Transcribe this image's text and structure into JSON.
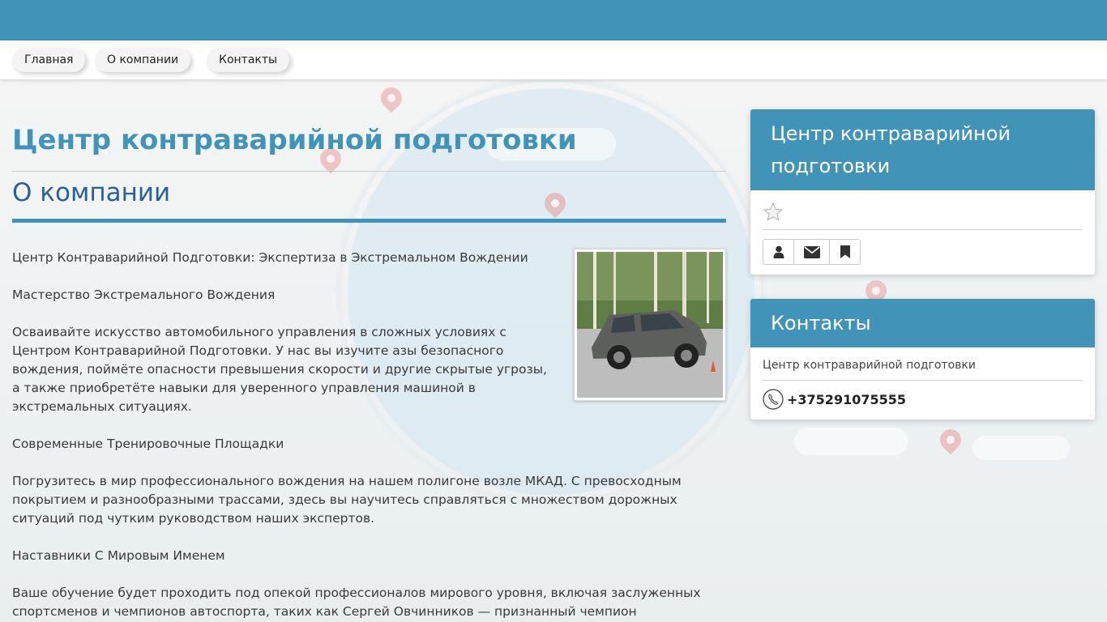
{
  "nav": {
    "items": [
      {
        "label": "Главная"
      },
      {
        "label": "О компании"
      },
      {
        "label": "Контакты"
      }
    ]
  },
  "main": {
    "site_title": "Центр контраварийной подготовки",
    "page_title": "О компании",
    "paragraphs": [
      "Центр Контраварийной Подготовки: Экспертиза в Экстремальном Вождении",
      "Мастерство Экстремального Вождения",
      "Осваивайте искусство автомобильного управления в сложных условиях с Центром Контраварийной Подготовки. У нас вы изучите азы безопасного вождения, поймёте опасности превышения скорости и другие скрытые угрозы, а также приобретёте навыки для уверенного управления машиной в экстремальных ситуациях.",
      "Современные Тренировочные Площадки",
      "Погрузитесь в мир профессионального вождения на нашем полигоне возле МКАД. С превосходным покрытием и разнообразными трассами, здесь вы научитесь справляться с множеством дорожных ситуаций под чутким руководством наших экспертов.",
      "Наставники С Мировым Именем",
      "Ваше обучение будет проходить под опекой профессионалов мирового уровня, включая заслуженных спортсменов и чемпионов автоспорта, таких как Сергей Овчинников — признанный чемпион"
    ]
  },
  "sidebar": {
    "company_widget": {
      "title": "Центр контраварийной подготовки",
      "buttons": [
        {
          "icon": "user-icon"
        },
        {
          "icon": "envelope-icon"
        },
        {
          "icon": "bookmark-icon"
        }
      ]
    },
    "contacts_widget": {
      "title": "Контакты",
      "company_name": "Центр контраварийной подготовки",
      "phone": "+375291075555"
    }
  },
  "colors": {
    "accent": "#4193b8",
    "page_title": "#2a5f9e"
  }
}
